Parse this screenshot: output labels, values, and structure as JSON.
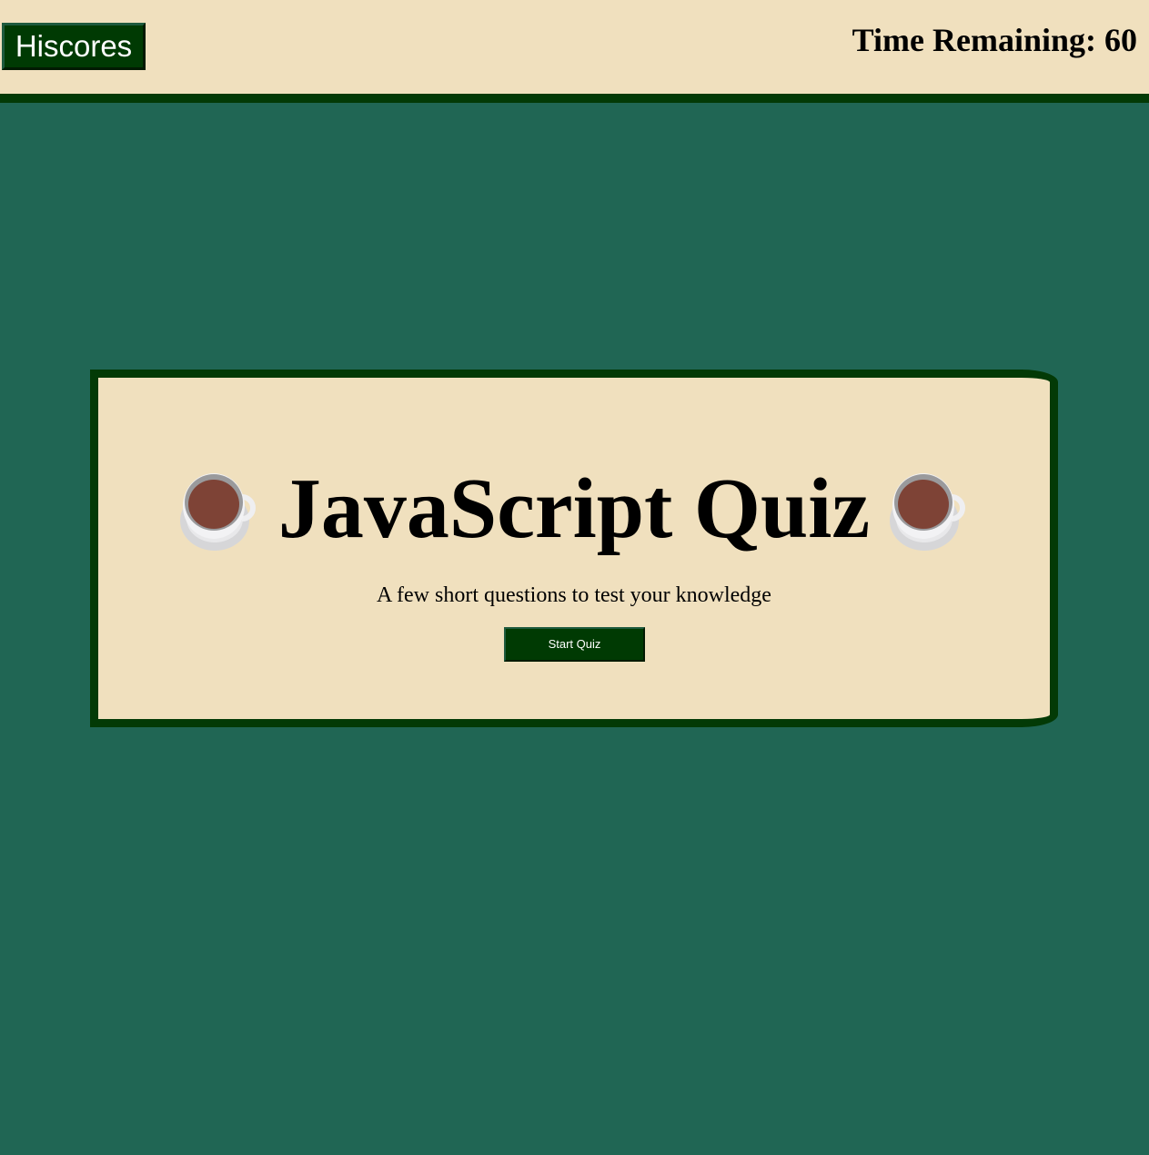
{
  "header": {
    "hiscores_label": "Hiscores",
    "timer_text": "Time Remaining: 60"
  },
  "card": {
    "title": "JavaScript Quiz",
    "subtitle": "A few short questions to test your knowledge",
    "start_label": "Start Quiz",
    "title_icon": "coffee-cup-icon"
  },
  "colors": {
    "page_background": "#206654",
    "panel_background": "#F0E0BE",
    "border_dark_green": "#033A06",
    "button_background": "#003A03",
    "button_text": "#FFFFFF"
  }
}
